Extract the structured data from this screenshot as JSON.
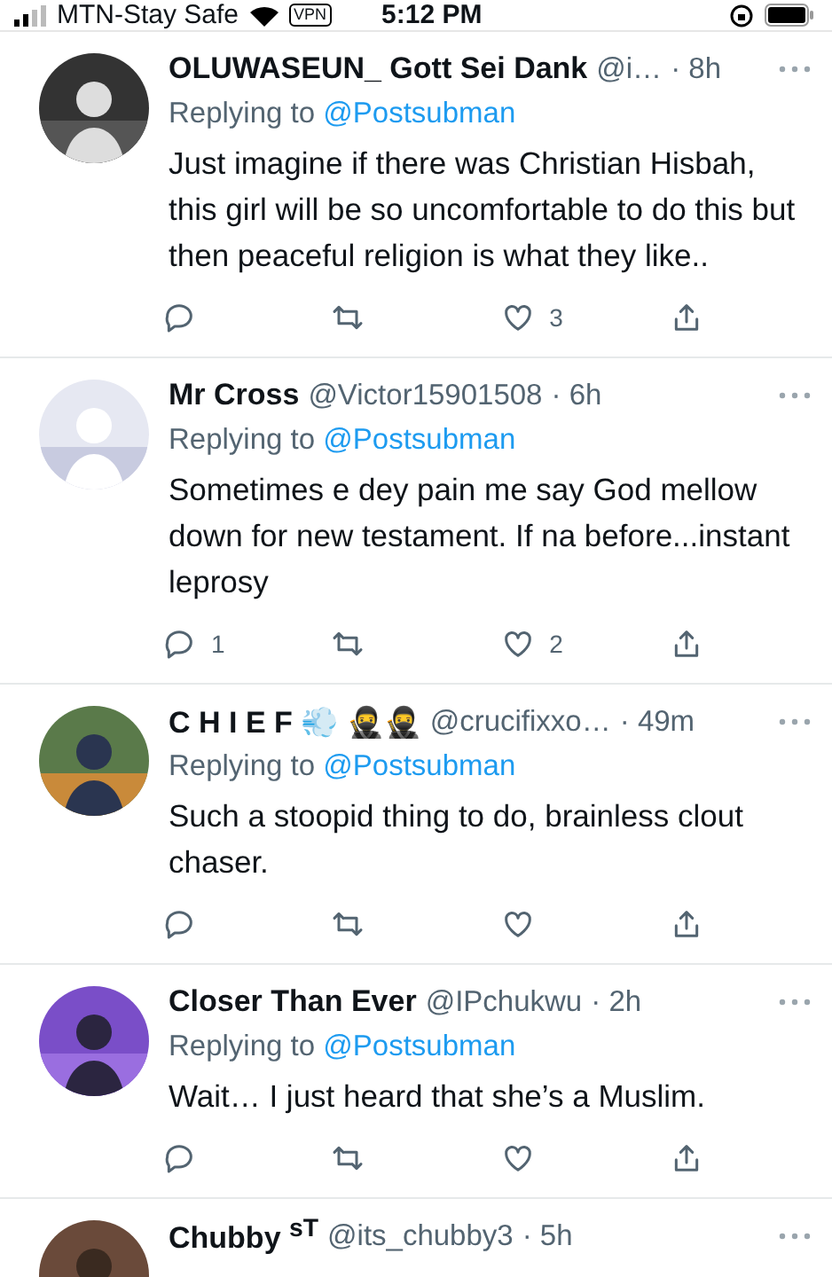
{
  "status_bar": {
    "carrier": "MTN-Stay Safe",
    "vpn": "VPN",
    "time": "5:12 PM"
  },
  "tweets": [
    {
      "name": "OLUWASEUN_ Gott Sei Dank",
      "handle": "@i…",
      "time": "· 8h",
      "replying_label": "Replying to",
      "replying_to": "@Postsubman",
      "text": "Just imagine if there was Christian Hisbah, this girl will be so uncomfortable to do this but then peaceful religion is what they like..",
      "likes": "3"
    },
    {
      "name": "Mr Cross",
      "handle": "@Victor15901508",
      "time": "· 6h",
      "replying_label": "Replying to",
      "replying_to": "@Postsubman",
      "text": "Sometimes e dey pain me say God mellow down for new testament. If na before...instant leprosy",
      "replies": "1",
      "likes": "2"
    },
    {
      "name": "C H I E F 💨 🥷🥷",
      "handle": "@crucifixxo…",
      "time": "· 49m",
      "replying_label": "Replying to",
      "replying_to": "@Postsubman",
      "text": "Such a stoopid thing to do, brainless clout chaser."
    },
    {
      "name": "Closer Than Ever",
      "handle": "@IPchukwu",
      "time": "· 2h",
      "replying_label": "Replying to",
      "replying_to": "@Postsubman",
      "text": "Wait… I just heard that she’s a Muslim."
    },
    {
      "name": "Chubby $^{sT}$",
      "handle": "@its_chubby3",
      "time": "· 5h"
    }
  ]
}
